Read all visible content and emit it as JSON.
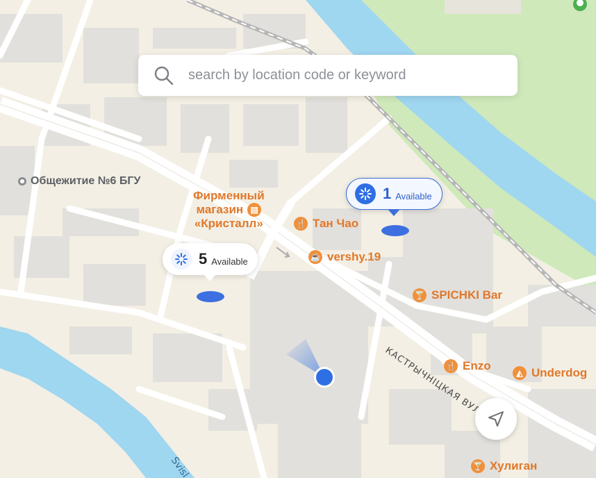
{
  "search": {
    "placeholder": "search by location code or keyword",
    "icon": "search-icon"
  },
  "clusters": [
    {
      "count": "1",
      "label": "Available",
      "selected": true,
      "icon": "spinner-icon"
    },
    {
      "count": "5",
      "label": "Available",
      "selected": false,
      "icon": "spinner-icon"
    }
  ],
  "places": {
    "dorm": "Общежитие №6 БГУ"
  },
  "pois": {
    "store_line1": "Фирменный",
    "store_line2": "магазин",
    "store_line3": "«Кристалл»",
    "tanchao": "Тан Чао",
    "vershy": "vershy.19",
    "spichki": "SPICHKI Bar",
    "enzo": "Enzo",
    "underdog": "Underdog",
    "huligan": "Хулиган"
  },
  "streets": {
    "kastrychnitskaya": "КАСТРЫЧНІЦКАЯ ВУЛІ"
  },
  "water": {
    "svisloch": "Svisl"
  },
  "colors": {
    "accent": "#2f6fe4",
    "poi": "#e0782a",
    "water": "#9fd6f0",
    "park": "#c9e8b5"
  }
}
